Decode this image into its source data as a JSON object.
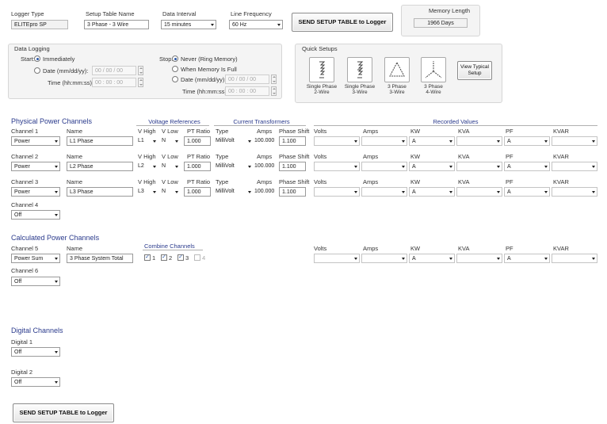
{
  "top": {
    "logger_type_label": "Logger Type",
    "logger_type_value": "ELITEpro SP",
    "setup_table_name_label": "Setup Table Name",
    "setup_table_name_value": "3 Phase - 3 Wire",
    "data_interval_label": "Data Interval",
    "data_interval_value": "15 minutes",
    "line_frequency_label": "Line Frequency",
    "line_frequency_value": "60 Hz",
    "send_button_label": "SEND SETUP TABLE to Logger",
    "memory_length_label": "Memory Length",
    "memory_length_value": "1966 Days"
  },
  "data_logging": {
    "title": "Data Logging",
    "start_label": "Start:",
    "immediately": "Immediately",
    "date_label": "Date (mm/dd/yy):",
    "date_value": "00 / 00 / 00",
    "time_label": "Time (hh:mm:ss):",
    "time_value": "00 : 00 : 00",
    "stop_label": "Stop:",
    "never": "Never (Ring Memory)",
    "when_full": "When Memory Is Full",
    "stop_date_label": "Date (mm/dd/yy):",
    "stop_date_value": "00 / 00 / 00",
    "stop_time_label": "Time (hh:mm:ss):",
    "stop_time_value": "00 : 00 : 00"
  },
  "quick_setups": {
    "title": "Quick Setups",
    "items": [
      {
        "l1": "Single Phase",
        "l2": "2-Wire"
      },
      {
        "l1": "Single Phase",
        "l2": "3-Wire"
      },
      {
        "l1": "3 Phase",
        "l2": "3-Wire"
      },
      {
        "l1": "3 Phase",
        "l2": "4-Wire"
      }
    ],
    "view_typical_l1": "View Typical",
    "view_typical_l2": "Setup"
  },
  "physical": {
    "title": "Physical Power Channels",
    "voltage_refs": "Voltage References",
    "current_transformers": "Current Transformers",
    "recorded_values": "Recorded Values",
    "col_name": "Name",
    "col_vhigh": "V High",
    "col_vlow": "V Low",
    "col_pt": "PT Ratio",
    "col_type": "Type",
    "col_amps": "Amps",
    "col_phase": "Phase Shift",
    "rv_cols": [
      "Volts",
      "Amps",
      "KW",
      "KVA",
      "PF",
      "KVAR"
    ],
    "channels": [
      {
        "label": "Channel 1",
        "mode": "Power",
        "name": "L1 Phase",
        "vhigh": "L1",
        "vlow": "N",
        "pt": "1.000",
        "type": "MilliVolt",
        "amps": "100.000",
        "phase": "1.100",
        "rv": [
          "",
          "",
          "A",
          "",
          "A",
          ""
        ]
      },
      {
        "label": "Channel 2",
        "mode": "Power",
        "name": "L2 Phase",
        "vhigh": "L2",
        "vlow": "N",
        "pt": "1.000",
        "type": "MilliVolt",
        "amps": "100.000",
        "phase": "1.100",
        "rv": [
          "",
          "",
          "A",
          "",
          "A",
          ""
        ]
      },
      {
        "label": "Channel 3",
        "mode": "Power",
        "name": "L3 Phase",
        "vhigh": "L3",
        "vlow": "N",
        "pt": "1.000",
        "type": "MilliVolt",
        "amps": "100.000",
        "phase": "1.100",
        "rv": [
          "",
          "",
          "A",
          "",
          "A",
          ""
        ]
      }
    ],
    "channel4_label": "Channel 4",
    "channel4_mode": "Off"
  },
  "calculated": {
    "title": "Calculated Power Channels",
    "channel5_label": "Channel 5",
    "channel5_mode": "Power Sum",
    "name_label": "Name",
    "name_value": "3 Phase System Total",
    "combine_title": "Combine Channels",
    "combine": [
      {
        "n": "1",
        "checked": true
      },
      {
        "n": "2",
        "checked": true
      },
      {
        "n": "3",
        "checked": true
      },
      {
        "n": "4",
        "checked": false
      }
    ],
    "rv_cols": [
      "Volts",
      "Amps",
      "KW",
      "KVA",
      "PF",
      "KVAR"
    ],
    "rv": [
      "",
      "",
      "A",
      "",
      "A",
      ""
    ],
    "channel6_label": "Channel 6",
    "channel6_mode": "Off"
  },
  "digital": {
    "title": "Digital Channels",
    "d1_label": "Digital 1",
    "d1_mode": "Off",
    "d2_label": "Digital 2",
    "d2_mode": "Off",
    "send_button_label": "SEND SETUP TABLE to Logger"
  }
}
